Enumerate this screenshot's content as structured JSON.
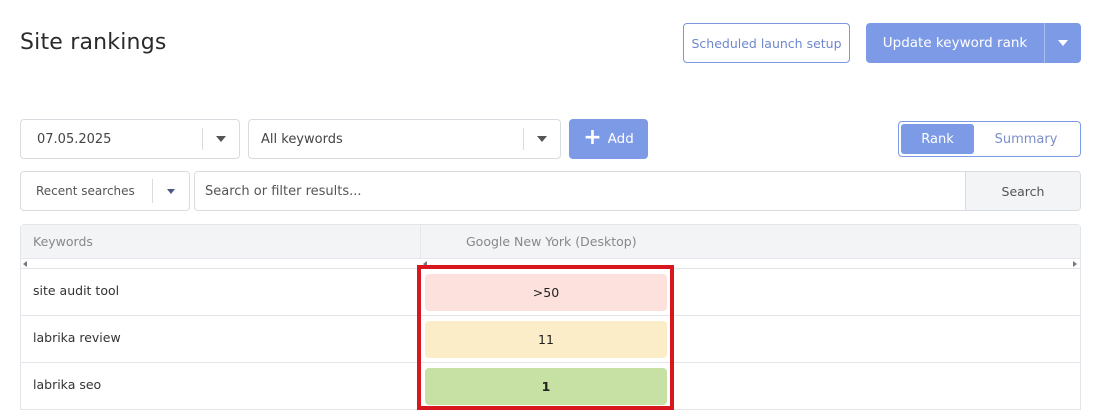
{
  "header": {
    "title": "Site rankings",
    "scheduled_label": "Scheduled launch setup",
    "update_label": "Update keyword rank"
  },
  "filters": {
    "date_value": "07.05.2025",
    "keywords_value": "All keywords",
    "add_label": "Add",
    "view_toggle": {
      "rank_label": "Rank",
      "summary_label": "Summary",
      "active": "Rank"
    },
    "recent_searches_label": "Recent searches",
    "search_placeholder": "Search or filter results...",
    "search_button_label": "Search"
  },
  "table": {
    "columns": [
      "Keywords",
      "Google New York (Desktop)"
    ],
    "rows": [
      {
        "keyword": "site audit tool",
        "rank": ">50",
        "color": "#fde1dc"
      },
      {
        "keyword": "labrika review",
        "rank": "11",
        "color": "#fcedc9"
      },
      {
        "keyword": "labrika seo",
        "rank": "1",
        "color": "#c6e1a3"
      }
    ]
  },
  "colors": {
    "accent": "#7d9ae6",
    "highlight_border": "#d7161d"
  }
}
